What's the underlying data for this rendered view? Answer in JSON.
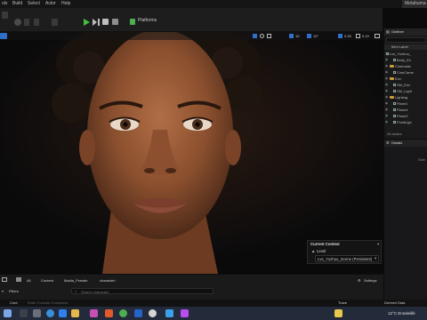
{
  "menu": {
    "items": [
      "ols",
      "Build",
      "Select",
      "Actor",
      "Help"
    ],
    "project_title": "Metahuma"
  },
  "toolbar": {
    "platforms_label": "Platforms"
  },
  "viewport": {
    "play_controls": [
      "play-icon",
      "step-icon",
      "stop-icon",
      "eject-icon"
    ],
    "right_tools": {
      "grid_snap": "10",
      "rotation_snap": "10°",
      "scale_snap": "0.25",
      "camera_speed": "0.19"
    },
    "subject": "metahuman-female-portrait"
  },
  "current_context": {
    "title": "Current Context",
    "level_label": "Level",
    "level_value": "Lvs_Yuzhuo_Scene (Persistent)"
  },
  "outliner": {
    "tab_label": "Outliner",
    "search_placeholder": "",
    "header": "Item Label",
    "items": [
      {
        "label": "Lvs_Yuzhuo_",
        "indent": 0,
        "folder": false
      },
      {
        "label": "Body_Ex",
        "indent": 2,
        "folder": false
      },
      {
        "label": "Cinematic",
        "indent": 1,
        "folder": true
      },
      {
        "label": "CineCame",
        "indent": 2,
        "folder": false
      },
      {
        "label": "Env",
        "indent": 1,
        "folder": true
      },
      {
        "label": "SM_Env",
        "indent": 2,
        "folder": false
      },
      {
        "label": "SM_Light",
        "indent": 2,
        "folder": false
      },
      {
        "label": "Lighting",
        "indent": 1,
        "folder": true
      },
      {
        "label": "Plane1",
        "indent": 2,
        "folder": false
      },
      {
        "label": "Plane4",
        "indent": 2,
        "folder": false
      },
      {
        "label": "Plane3",
        "indent": 2,
        "folder": false
      },
      {
        "label": "PointLigh",
        "indent": 2,
        "folder": false
      }
    ],
    "count_label": "26 actors"
  },
  "details": {
    "tab_label": "Details",
    "placeholder_text": "Sele"
  },
  "content_browser": {
    "breadcrumb": [
      "All",
      "Content",
      "Madia_Female",
      "characterl"
    ],
    "settings_label": "Settings",
    "filters_label": "Filters",
    "search_placeholder": "Search characterl"
  },
  "statusbar": {
    "cmd_label": "Cmd",
    "cmd_placeholder": "Enter Console Command",
    "trace_label": "Trace",
    "derived_label": "Derived Data"
  },
  "taskbar": {
    "weather": "12°C  Ensoleillé"
  },
  "colors": {
    "accent": "#2f6fc9",
    "play_green": "#3fbf3f",
    "folder": "#c59b3a",
    "taskbar": "#232a3a"
  }
}
